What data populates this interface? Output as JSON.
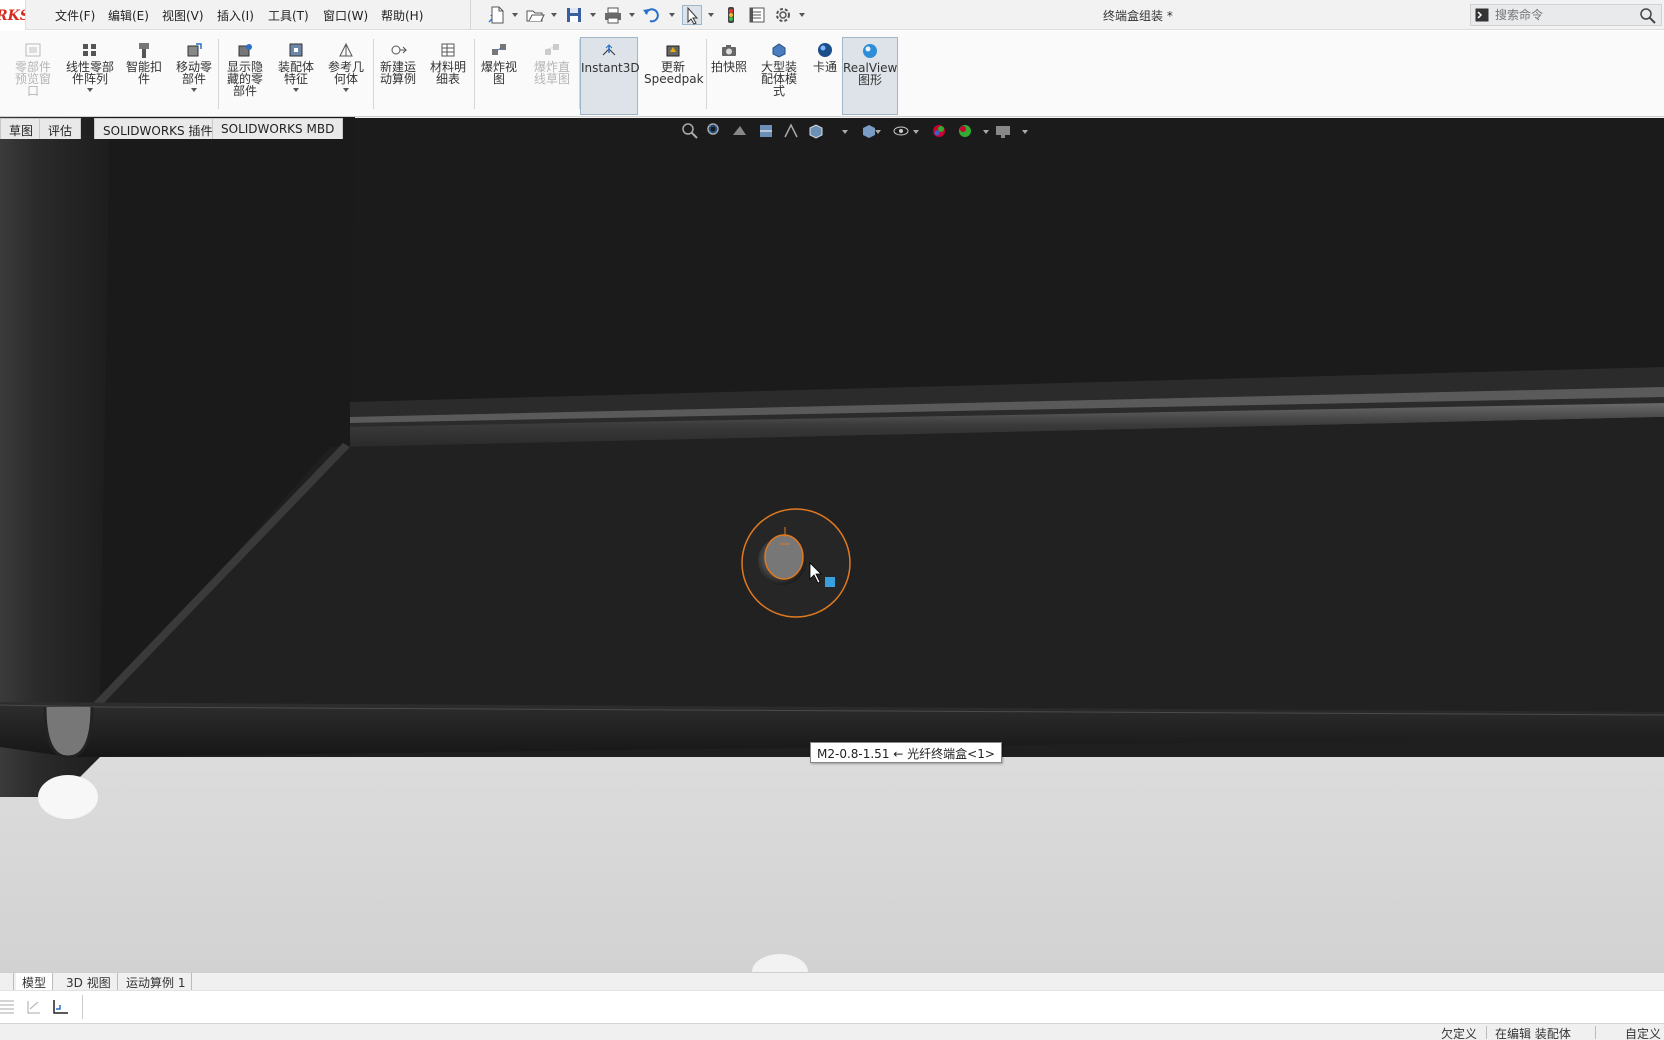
{
  "app": {
    "logo_text": "RKS",
    "document_title": "终端盒组装 *"
  },
  "menu": [
    {
      "label": "文件(F)",
      "name": "menu-file"
    },
    {
      "label": "编辑(E)",
      "name": "menu-edit"
    },
    {
      "label": "视图(V)",
      "name": "menu-view"
    },
    {
      "label": "插入(I)",
      "name": "menu-insert"
    },
    {
      "label": "工具(T)",
      "name": "menu-tools"
    },
    {
      "label": "窗口(W)",
      "name": "menu-window"
    },
    {
      "label": "帮助(H)",
      "name": "menu-help"
    }
  ],
  "search": {
    "placeholder": "搜索命令"
  },
  "commands": [
    {
      "label": "零部件\n预览窗\n口",
      "name": "component-preview-window",
      "icon": "preview-window-icon",
      "disabled": true
    },
    {
      "label": "线性零部\n件阵列",
      "name": "linear-component-pattern",
      "icon": "linear-pattern-icon",
      "caret": true
    },
    {
      "label": "智能扣\n件",
      "name": "smart-fasteners",
      "icon": "smart-fastener-icon"
    },
    {
      "label": "移动零\n部件",
      "name": "move-component",
      "icon": "move-component-icon",
      "caret": true
    },
    {
      "label": "显示隐\n藏的零\n部件",
      "name": "show-hidden-components",
      "icon": "show-hidden-icon"
    },
    {
      "label": "装配体\n特征",
      "name": "assembly-features",
      "icon": "assembly-feature-icon",
      "caret": true
    },
    {
      "label": "参考几\n何体",
      "name": "reference-geometry",
      "icon": "reference-geometry-icon",
      "caret": true
    },
    {
      "label": "新建运\n动算例",
      "name": "new-motion-study",
      "icon": "motion-study-icon"
    },
    {
      "label": "材料明\n细表",
      "name": "bill-of-materials",
      "icon": "bom-icon"
    },
    {
      "label": "爆炸视\n图",
      "name": "exploded-view",
      "icon": "exploded-view-icon"
    },
    {
      "label": "爆炸直\n线草图",
      "name": "explode-line-sketch",
      "icon": "explode-line-icon",
      "disabled": true
    },
    {
      "label": "Instant3D",
      "name": "instant3d",
      "icon": "instant3d-icon",
      "pressed": true
    },
    {
      "label": "更新\nSpeedpak",
      "name": "update-speedpak",
      "icon": "speedpak-icon"
    },
    {
      "label": "拍快照",
      "name": "take-snapshot",
      "icon": "camera-icon"
    },
    {
      "label": "大型装\n配体模\n式",
      "name": "large-assembly-mode",
      "icon": "large-assembly-icon"
    },
    {
      "label": "卡通",
      "name": "cartoon",
      "icon": "cartoon-sphere-icon"
    },
    {
      "label": "RealView\n图形",
      "name": "realview-graphics",
      "icon": "realview-icon",
      "pressed": true
    }
  ],
  "tabs": [
    {
      "label": "草图",
      "name": "tab-sketch"
    },
    {
      "label": "评估",
      "name": "tab-evaluate"
    },
    {
      "label": "SOLIDWORKS 插件",
      "name": "tab-solidworks-addins"
    },
    {
      "label": "SOLIDWORKS MBD",
      "name": "tab-solidworks-mbd"
    }
  ],
  "viewport": {
    "tooltip": "M2-0.8-1.51 ← 光纤终端盒<1>"
  },
  "bottom_tabs": [
    {
      "label": "模型",
      "name": "tab-model",
      "active": true
    },
    {
      "label": "3D 视图",
      "name": "tab-3d-views"
    },
    {
      "label": "运动算例 1",
      "name": "tab-motion-study-1"
    }
  ],
  "status": {
    "definition": "欠定义",
    "editing": "在编辑 装配体",
    "custom": "自定义"
  }
}
